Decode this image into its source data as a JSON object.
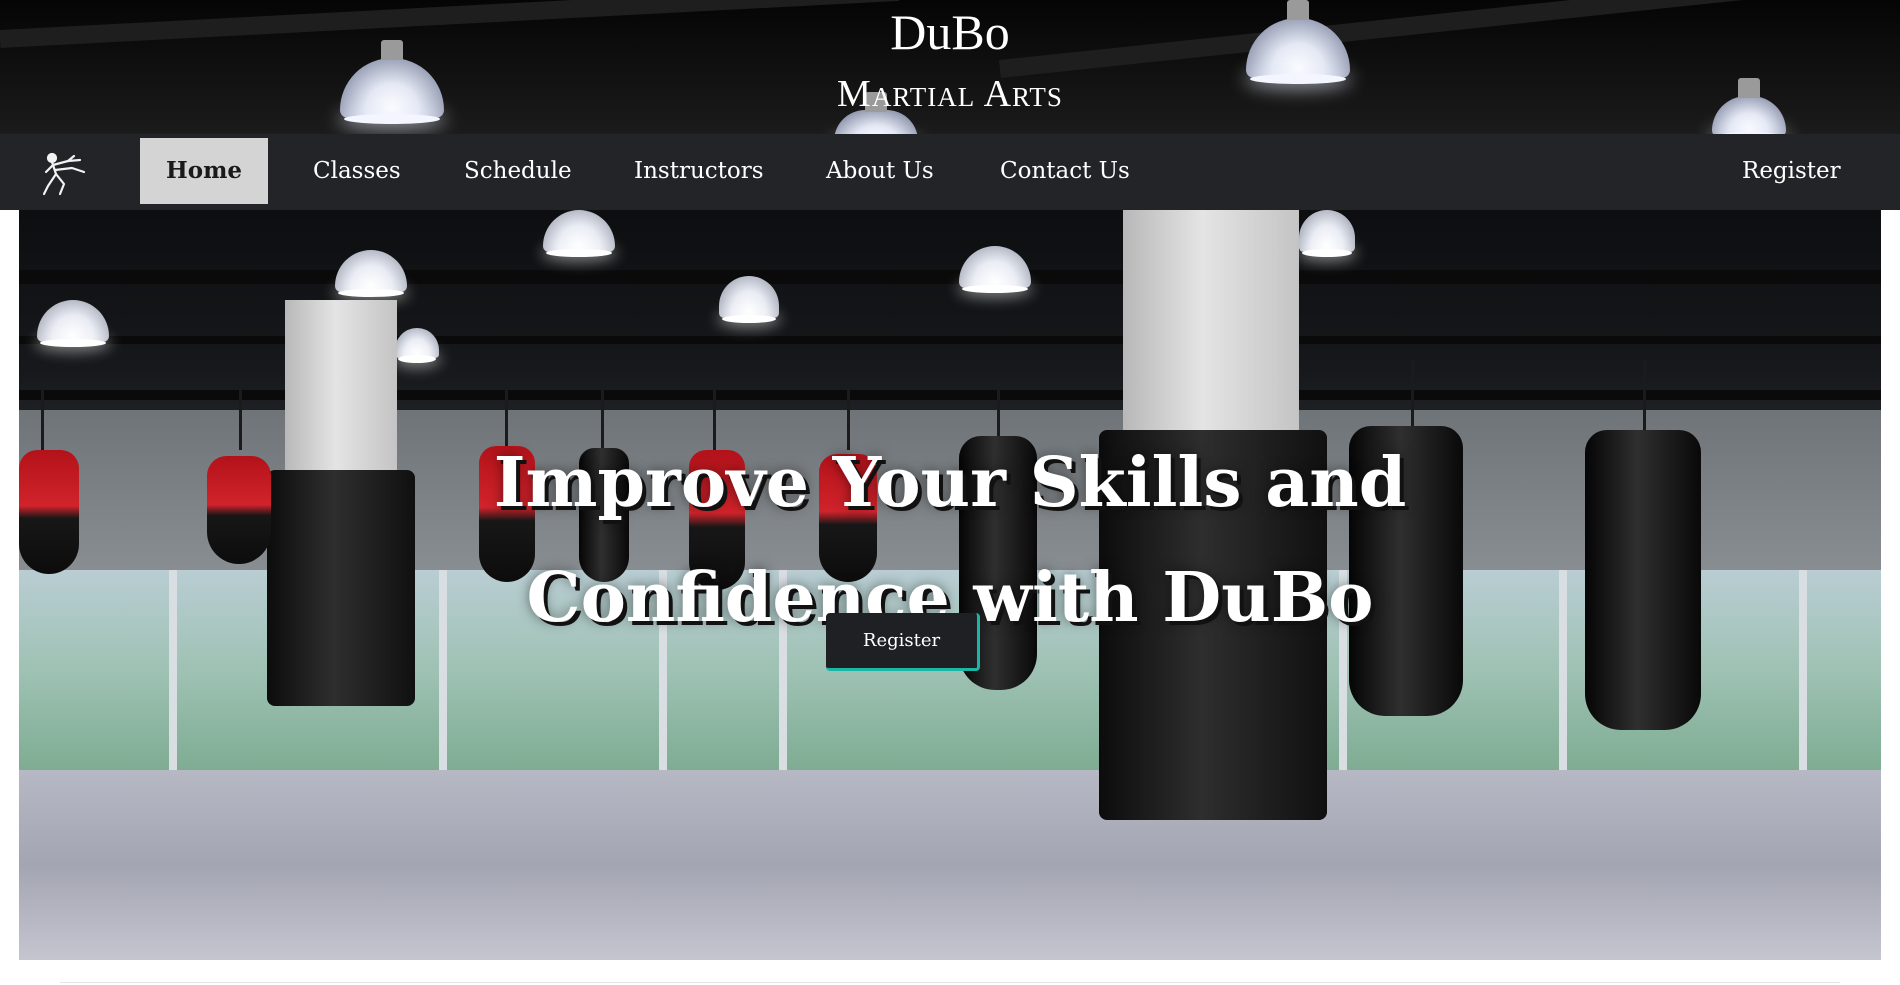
{
  "brand": {
    "name": "DuBo",
    "subtitle": "Martial Arts"
  },
  "nav": {
    "logo_icon": "martial-artist-kick-icon",
    "items": [
      {
        "label": "Home",
        "active": true
      },
      {
        "label": "Classes",
        "active": false
      },
      {
        "label": "Schedule",
        "active": false
      },
      {
        "label": "Instructors",
        "active": false
      },
      {
        "label": "About Us",
        "active": false
      },
      {
        "label": "Contact Us",
        "active": false
      }
    ],
    "register_label": "Register"
  },
  "hero": {
    "title_line1": "Improve Your Skills and",
    "title_line2": "Confidence with DuBo",
    "cta_label": "Register"
  },
  "colors": {
    "navbar_bg": "#232427",
    "active_tab_bg": "#d4d4d4",
    "cta_accent": "#1ab7a8",
    "cta_bg": "#1f2024"
  }
}
